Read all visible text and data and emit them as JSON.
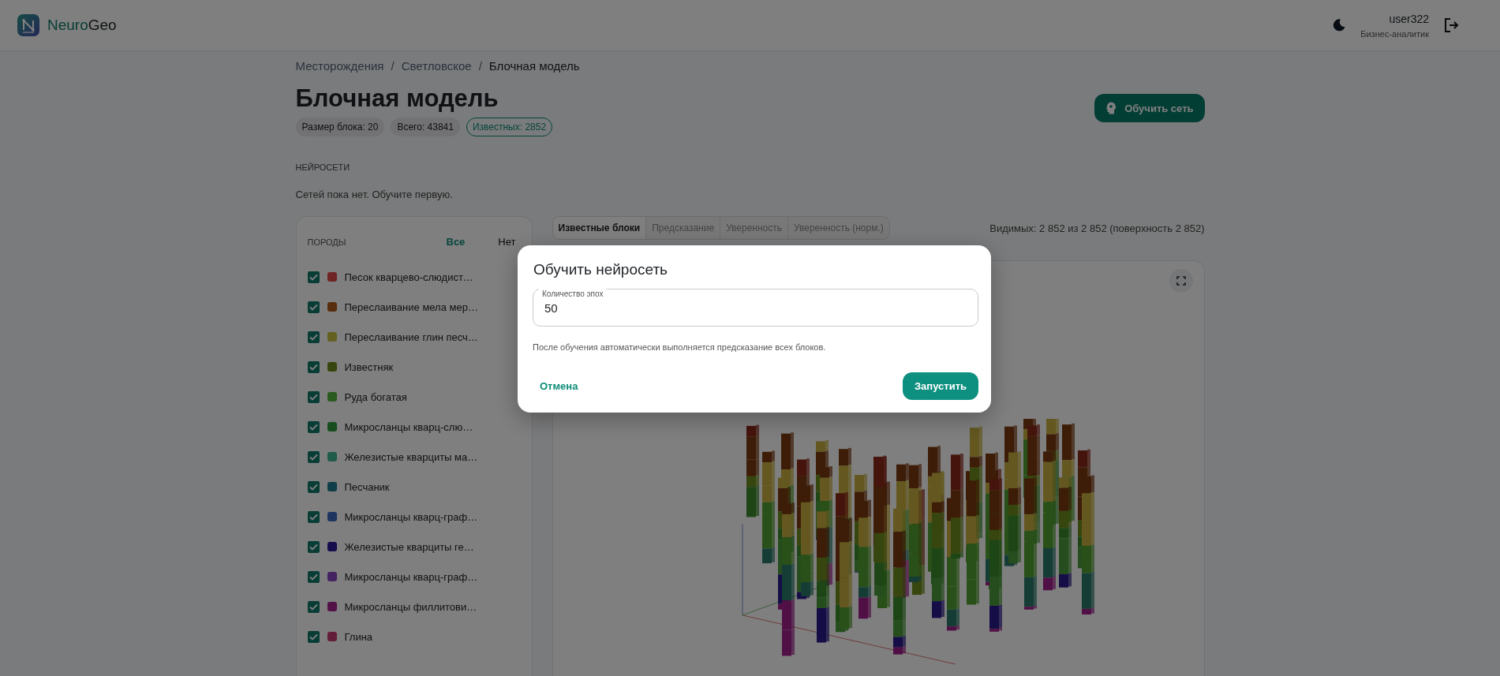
{
  "header": {
    "logo": {
      "accent": "Neuro",
      "rest": "Geo"
    },
    "user": {
      "name": "user322",
      "role": "Бизнес-аналитик"
    }
  },
  "breadcrumbs": [
    {
      "label": "Месторождения",
      "separator": "/"
    },
    {
      "label": "Светловское",
      "separator": "/"
    },
    {
      "label": "Блочная модель"
    }
  ],
  "title": "Блочная модель",
  "chips": [
    {
      "label": "Размер блока: 20",
      "kind": "plain"
    },
    {
      "label": "Всего: 43841",
      "kind": "plain"
    },
    {
      "label": "Известных: 2852",
      "kind": "outlined"
    }
  ],
  "train_button": "Обучить сеть",
  "networks": {
    "heading": "НЕЙРОСЕТИ",
    "empty": "Сетей пока нет. Обучите первую."
  },
  "rocks": {
    "heading": "ПОРОДЫ",
    "all": "Все",
    "none": "Нет",
    "items": [
      {
        "label": "Песок кварцево-слюдист…",
        "color": "#702525",
        "checked": true
      },
      {
        "label": "Переслаивание мела мер…",
        "color": "#582d0e",
        "checked": true
      },
      {
        "label": "Переслаивание глин песч…",
        "color": "#646020",
        "checked": true
      },
      {
        "label": "Известняк",
        "color": "#37460e",
        "checked": true
      },
      {
        "label": "Руда богатая",
        "color": "#295a1e",
        "checked": true
      },
      {
        "label": "Микросланцы кварц-слю…",
        "color": "#174d1f",
        "checked": true
      },
      {
        "label": "Железистые кварциты ма…",
        "color": "#205c4a",
        "checked": true
      },
      {
        "label": "Песчаник",
        "color": "#0f3d48",
        "checked": true
      },
      {
        "label": "Микросланцы кварц-граф…",
        "color": "#203460",
        "checked": true
      },
      {
        "label": "Железистые кварциты ге…",
        "color": "#150d4e",
        "checked": true
      },
      {
        "label": "Микросланцы кварц-граф…",
        "color": "#452262",
        "checked": true
      },
      {
        "label": "Микросланцы филлитови…",
        "color": "#521147",
        "checked": true
      },
      {
        "label": "Глина",
        "color": "#621e38",
        "checked": true
      }
    ]
  },
  "view_tabs": [
    {
      "label": "Известные блоки",
      "selected": true
    },
    {
      "label": "Предсказание",
      "selected": false
    },
    {
      "label": "Уверенность",
      "selected": false
    },
    {
      "label": "Уверенность (норм.)",
      "selected": false
    }
  ],
  "visible_count": "Видимых: 2 852 из 2 852 (поверхность 2 852)",
  "dialog": {
    "title": "Обучить нейросеть",
    "field": {
      "label": "Количество эпох",
      "value": "50"
    },
    "hint": "После обучения автоматически выполняется предсказание всех блоков.",
    "cancel": "Отмена",
    "submit": "Запустить"
  }
}
